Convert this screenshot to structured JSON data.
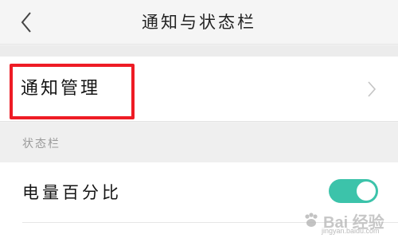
{
  "header": {
    "title": "通知与状态栏",
    "back_icon": "chevron-left-icon"
  },
  "settings": {
    "notification_management": {
      "label": "通知管理",
      "chevron_icon": "chevron-right-icon",
      "highlight_color": "#ee1c25"
    },
    "status_bar_section": {
      "label": "状态栏"
    },
    "battery_percentage": {
      "label": "电量百分比",
      "toggle_on": true,
      "toggle_color": "#3cc3aa"
    }
  },
  "watermark": {
    "text": "Bai 经验",
    "subtext": "jingyan.baidu.com",
    "icon": "baidu-paw-icon"
  }
}
